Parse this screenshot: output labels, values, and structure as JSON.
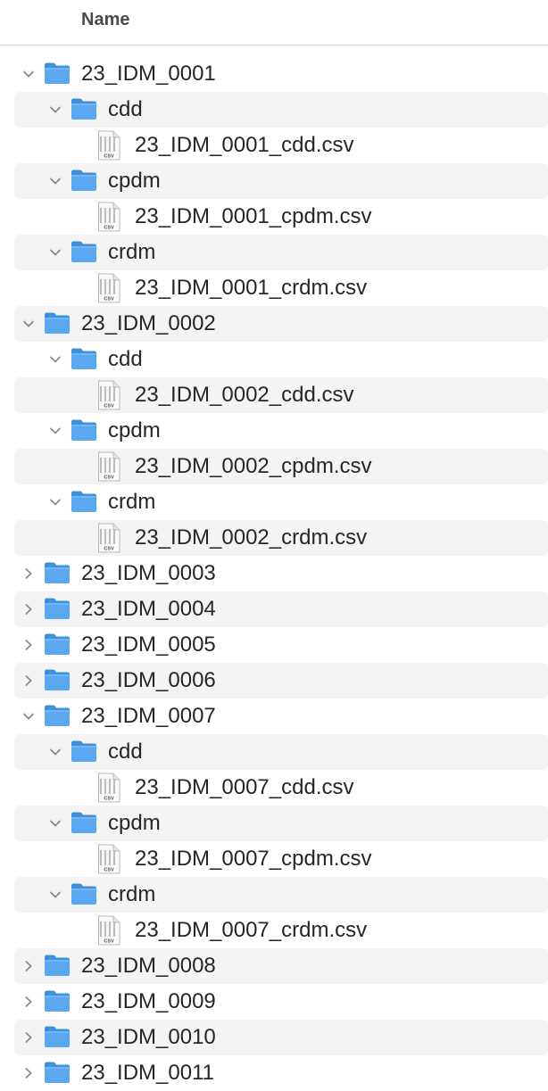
{
  "header": {
    "name_label": "Name"
  },
  "icons": {
    "folder": "folder-icon",
    "file": "csv-file-icon",
    "chevron_open": "chevron-down-icon",
    "chevron_closed": "chevron-right-icon"
  },
  "colors": {
    "folder": "#5aa9f0",
    "stripe": "#f4f4f5"
  },
  "file_badge": "CSV",
  "rows": [
    {
      "label": "23_IDM_0001",
      "level": 0,
      "kind": "folder",
      "expanded": true
    },
    {
      "label": "cdd",
      "level": 1,
      "kind": "folder",
      "expanded": true
    },
    {
      "label": "23_IDM_0001_cdd.csv",
      "level": 2,
      "kind": "file"
    },
    {
      "label": "cpdm",
      "level": 1,
      "kind": "folder",
      "expanded": true
    },
    {
      "label": "23_IDM_0001_cpdm.csv",
      "level": 2,
      "kind": "file"
    },
    {
      "label": "crdm",
      "level": 1,
      "kind": "folder",
      "expanded": true
    },
    {
      "label": "23_IDM_0001_crdm.csv",
      "level": 2,
      "kind": "file"
    },
    {
      "label": "23_IDM_0002",
      "level": 0,
      "kind": "folder",
      "expanded": true
    },
    {
      "label": "cdd",
      "level": 1,
      "kind": "folder",
      "expanded": true
    },
    {
      "label": "23_IDM_0002_cdd.csv",
      "level": 2,
      "kind": "file"
    },
    {
      "label": "cpdm",
      "level": 1,
      "kind": "folder",
      "expanded": true
    },
    {
      "label": "23_IDM_0002_cpdm.csv",
      "level": 2,
      "kind": "file"
    },
    {
      "label": "crdm",
      "level": 1,
      "kind": "folder",
      "expanded": true
    },
    {
      "label": "23_IDM_0002_crdm.csv",
      "level": 2,
      "kind": "file"
    },
    {
      "label": "23_IDM_0003",
      "level": 0,
      "kind": "folder",
      "expanded": false
    },
    {
      "label": "23_IDM_0004",
      "level": 0,
      "kind": "folder",
      "expanded": false
    },
    {
      "label": "23_IDM_0005",
      "level": 0,
      "kind": "folder",
      "expanded": false
    },
    {
      "label": "23_IDM_0006",
      "level": 0,
      "kind": "folder",
      "expanded": false
    },
    {
      "label": "23_IDM_0007",
      "level": 0,
      "kind": "folder",
      "expanded": true
    },
    {
      "label": "cdd",
      "level": 1,
      "kind": "folder",
      "expanded": true
    },
    {
      "label": "23_IDM_0007_cdd.csv",
      "level": 2,
      "kind": "file"
    },
    {
      "label": "cpdm",
      "level": 1,
      "kind": "folder",
      "expanded": true
    },
    {
      "label": "23_IDM_0007_cpdm.csv",
      "level": 2,
      "kind": "file"
    },
    {
      "label": "crdm",
      "level": 1,
      "kind": "folder",
      "expanded": true
    },
    {
      "label": "23_IDM_0007_crdm.csv",
      "level": 2,
      "kind": "file"
    },
    {
      "label": "23_IDM_0008",
      "level": 0,
      "kind": "folder",
      "expanded": false
    },
    {
      "label": "23_IDM_0009",
      "level": 0,
      "kind": "folder",
      "expanded": false
    },
    {
      "label": "23_IDM_0010",
      "level": 0,
      "kind": "folder",
      "expanded": false
    },
    {
      "label": "23_IDM_0011",
      "level": 0,
      "kind": "folder",
      "expanded": false
    }
  ]
}
